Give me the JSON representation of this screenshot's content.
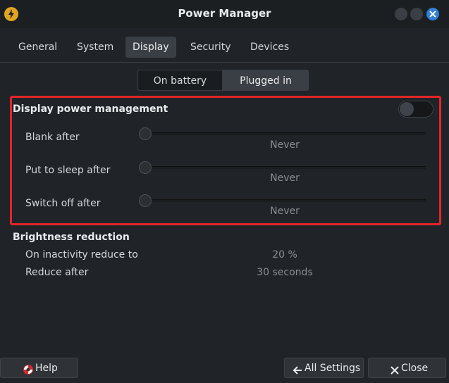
{
  "window": {
    "title": "Power Manager"
  },
  "tabs": [
    {
      "label": "General"
    },
    {
      "label": "System"
    },
    {
      "label": "Display"
    },
    {
      "label": "Security"
    },
    {
      "label": "Devices"
    }
  ],
  "active_tab": "Display",
  "power_source": {
    "on_battery": "On battery",
    "plugged_in": "Plugged in",
    "selected": "Plugged in"
  },
  "display_power_management": {
    "title": "Display power management",
    "enabled": false,
    "rows": [
      {
        "label": "Blank after",
        "value": "Never"
      },
      {
        "label": "Put to sleep after",
        "value": "Never"
      },
      {
        "label": "Switch off after",
        "value": "Never"
      }
    ]
  },
  "brightness_reduction": {
    "title": "Brightness reduction",
    "rows": [
      {
        "label": "On inactivity reduce to",
        "value": "20 %"
      },
      {
        "label": "Reduce after",
        "value": "30 seconds"
      }
    ]
  },
  "buttons": {
    "help": "Help",
    "all_settings": "All Settings",
    "close": "Close"
  },
  "colors": {
    "accent": "#2f7fd6",
    "highlight": "#e3252a",
    "app_icon": "#e0a520"
  }
}
